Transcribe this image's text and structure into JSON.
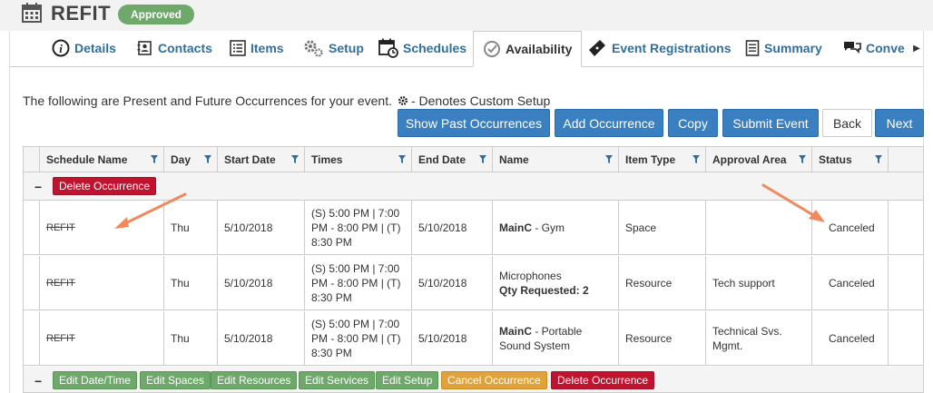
{
  "header": {
    "title": "REFIT",
    "status_badge": "Approved"
  },
  "tabs": [
    {
      "label": "Details",
      "icon": "info-icon",
      "active": false
    },
    {
      "label": "Contacts",
      "icon": "contacts-icon",
      "active": false
    },
    {
      "label": "Items",
      "icon": "list-icon",
      "active": false
    },
    {
      "label": "Setup",
      "icon": "gears-icon",
      "active": false
    },
    {
      "label": "Schedules",
      "icon": "calendar-clock-icon",
      "active": false
    },
    {
      "label": "Availability",
      "icon": "check-circle-icon",
      "active": true
    },
    {
      "label": "Event Registrations",
      "icon": "ticket-icon",
      "active": false
    },
    {
      "label": "Summary",
      "icon": "document-icon",
      "active": false
    },
    {
      "label": "Conve",
      "icon": "chat-icon",
      "active": false
    }
  ],
  "info_text": "The following are Present and Future Occurrences for your event.",
  "info_suffix": "- Denotes Custom Setup",
  "actions": {
    "show_past": "Show Past Occurrences",
    "add": "Add Occurrence",
    "copy": "Copy",
    "submit": "Submit Event",
    "back": "Back",
    "next": "Next"
  },
  "columns": [
    "Schedule Name",
    "Day",
    "Start Date",
    "Times",
    "End Date",
    "Name",
    "Item Type",
    "Approval Area",
    "Status"
  ],
  "groups": [
    {
      "buttons": [
        "Delete Occurrence"
      ]
    },
    {
      "buttons": [
        "Edit Date/Time",
        "Edit Spaces",
        "Edit Resources",
        "Edit Services",
        "Edit Setup",
        "Cancel Occurrence",
        "Delete Occurrence"
      ]
    }
  ],
  "rows": [
    {
      "schedule_name": "REFIT",
      "day": "Thu",
      "start_date": "5/10/2018",
      "times": "(S) 5:00 PM | 7:00 PM - 8:00 PM | (T) 8:30 PM",
      "end_date": "5/10/2018",
      "name_bold": "MainC",
      "name_rest": " - Gym",
      "item_type": "Space",
      "approval_area": "",
      "status": "Canceled"
    },
    {
      "schedule_name": "REFIT",
      "day": "Thu",
      "start_date": "5/10/2018",
      "times": "(S) 5:00 PM | 7:00 PM - 8:00 PM | (T) 8:30 PM",
      "end_date": "5/10/2018",
      "name_line1": "Microphones",
      "name_line2": "Qty Requested: 2",
      "item_type": "Resource",
      "approval_area": "Tech support",
      "status": "Canceled"
    },
    {
      "schedule_name": "REFIT",
      "day": "Thu",
      "start_date": "5/10/2018",
      "times": "(S) 5:00 PM | 7:00 PM - 8:00 PM | (T) 8:30 PM",
      "end_date": "5/10/2018",
      "name_bold": "MainC",
      "name_rest": " - Portable Sound System",
      "item_type": "Resource",
      "approval_area": "Technical Svs. Mgmt.",
      "status": "Canceled"
    }
  ],
  "colors": {
    "primary_blue": "#3a7fc0",
    "tab_text": "#2f6f9f",
    "approved_green": "#6ea86a",
    "danger_red": "#c0132f",
    "warning_orange": "#e0a23a",
    "annotation_arrow": "#f08a5d"
  }
}
